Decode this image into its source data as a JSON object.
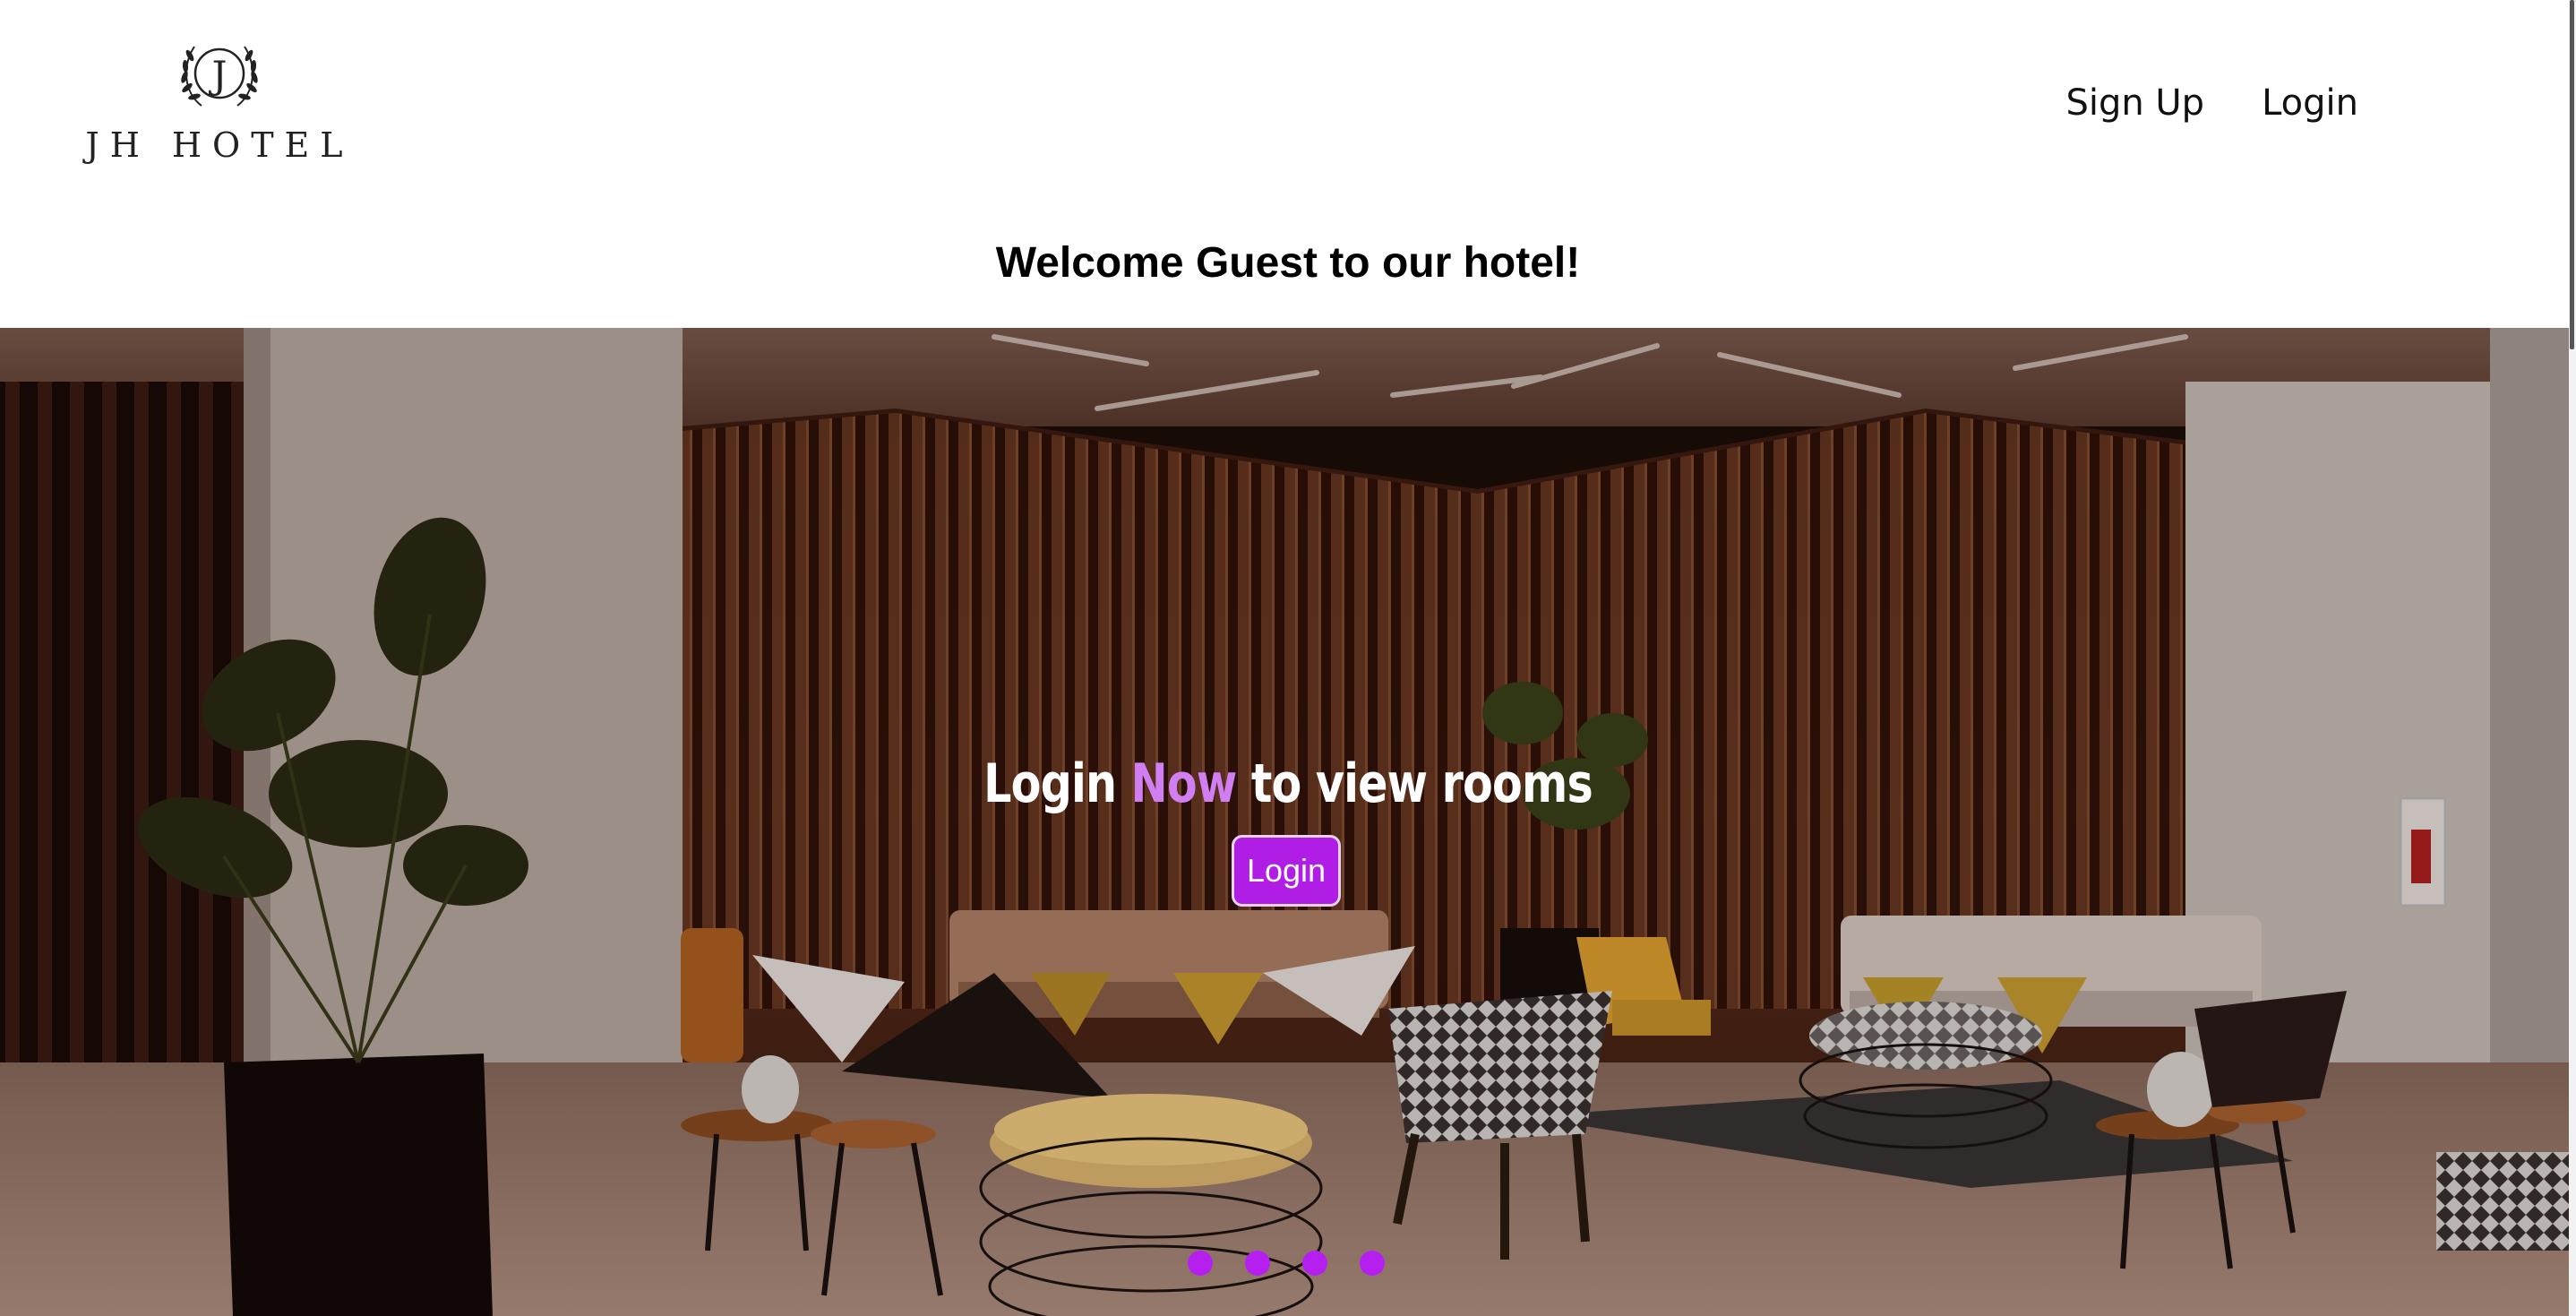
{
  "brand": {
    "name": "JH HOTEL",
    "emblem_letter": "J"
  },
  "nav": {
    "signup_label": "Sign Up",
    "login_label": "Login"
  },
  "welcome_text": "Welcome Guest to our hotel!",
  "hero": {
    "title_before": "Login",
    "title_accent": "Now",
    "title_after": "to view rooms",
    "login_button_label": "Login",
    "slides": 4
  },
  "colors": {
    "accent": "#b01ee6",
    "accent_light": "#d07ef2"
  }
}
